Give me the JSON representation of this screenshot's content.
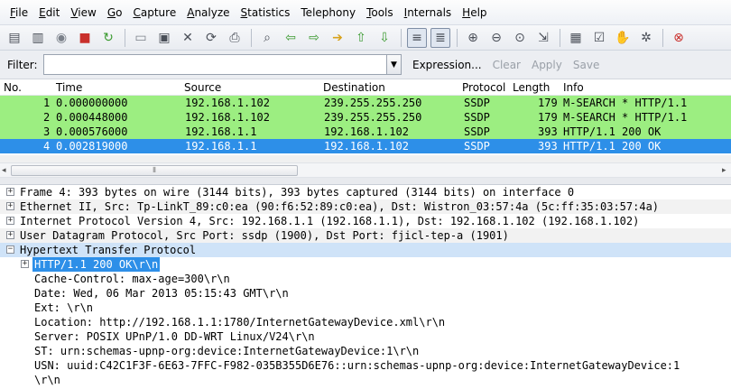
{
  "menu": [
    {
      "u": "F",
      "rest": "ile"
    },
    {
      "u": "E",
      "rest": "dit"
    },
    {
      "u": "V",
      "rest": "iew"
    },
    {
      "u": "G",
      "rest": "o"
    },
    {
      "u": "C",
      "rest": "apture"
    },
    {
      "u": "A",
      "rest": "nalyze"
    },
    {
      "u": "S",
      "rest": "tatistics"
    },
    {
      "u": "",
      "rest": "Telephony"
    },
    {
      "u": "T",
      "rest": "ools"
    },
    {
      "u": "I",
      "rest": "nternals"
    },
    {
      "u": "H",
      "rest": "elp"
    }
  ],
  "toolbar_glyphs": {
    "interfaces": "▤",
    "options": "▥",
    "start": "◉",
    "stop": "■",
    "restart": "↻",
    "open": "▭",
    "save": "▣",
    "close": "✕",
    "reload": "⟳",
    "print": "⎙",
    "find": "⌕",
    "back": "⇦",
    "forward": "⇨",
    "goto": "➔",
    "first": "⇧",
    "last": "⇩",
    "colorize": "≡",
    "autoscroll": "≣",
    "zoom_in": "⊕",
    "zoom_out": "⊖",
    "zoom_normal": "⊙",
    "resize": "⇲",
    "capture_filters": "▦",
    "display_filters": "☑",
    "coloring_rules": "✋",
    "preferences": "✲",
    "help": "⊗"
  },
  "filter": {
    "label": "Filter:",
    "value": "",
    "expression": "Expression...",
    "clear": "Clear",
    "apply": "Apply",
    "save": "Save"
  },
  "packet_list": {
    "columns": [
      "No.",
      "Time",
      "Source",
      "Destination",
      "Protocol",
      "Length",
      "Info"
    ],
    "rows": [
      {
        "no": "1",
        "time": "0.000000000",
        "source": "192.168.1.102",
        "destination": "239.255.255.250",
        "protocol": "SSDP",
        "length": "179",
        "info": "M-SEARCH * HTTP/1.1"
      },
      {
        "no": "2",
        "time": "0.000448000",
        "source": "192.168.1.102",
        "destination": "239.255.255.250",
        "protocol": "SSDP",
        "length": "179",
        "info": "M-SEARCH * HTTP/1.1"
      },
      {
        "no": "3",
        "time": "0.000576000",
        "source": "192.168.1.1",
        "destination": "192.168.1.102",
        "protocol": "SSDP",
        "length": "393",
        "info": "HTTP/1.1 200 OK"
      },
      {
        "no": "4",
        "time": "0.002819000",
        "source": "192.168.1.1",
        "destination": "192.168.1.102",
        "protocol": "SSDP",
        "length": "393",
        "info": "HTTP/1.1 200 OK"
      }
    ],
    "colors": {
      "green": "#9cee81",
      "selected": "#2d8fe8"
    }
  },
  "details": {
    "frame": "Frame 4: 393 bytes on wire (3144 bits), 393 bytes captured (3144 bits) on interface 0",
    "ethernet": "Ethernet II, Src: Tp-LinkT_89:c0:ea (90:f6:52:89:c0:ea), Dst: Wistron_03:57:4a (5c:ff:35:03:57:4a)",
    "ip": "Internet Protocol Version 4, Src: 192.168.1.1 (192.168.1.1), Dst: 192.168.1.102 (192.168.1.102)",
    "udp": "User Datagram Protocol, Src Port: ssdp (1900), Dst Port: fjicl-tep-a (1901)",
    "http": "Hypertext Transfer Protocol",
    "status_line": "HTTP/1.1 200 OK\\r\\n",
    "cache_control": "Cache-Control: max-age=300\\r\\n",
    "date": "Date: Wed, 06 Mar 2013 05:15:43 GMT\\r\\n",
    "ext": "Ext: \\r\\n",
    "location": "Location: http://192.168.1.1:1780/InternetGatewayDevice.xml\\r\\n",
    "server": "Server: POSIX UPnP/1.0 DD-WRT Linux/V24\\r\\n",
    "st": "ST: urn:schemas-upnp-org:device:InternetGatewayDevice:1\\r\\n",
    "usn": "USN: uuid:C42C1F3F-6E63-7FFC-F982-035B355D6E76::urn:schemas-upnp-org:device:InternetGatewayDevice:1",
    "usn_cont": "\\r\\n"
  }
}
